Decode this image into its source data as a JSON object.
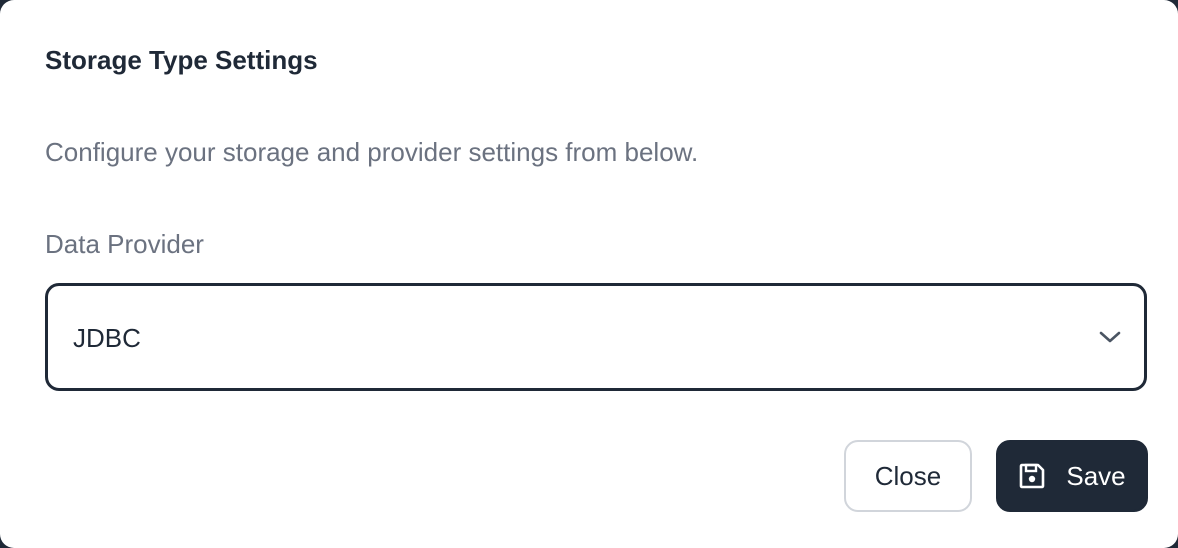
{
  "dialog": {
    "title": "Storage Type Settings",
    "description": "Configure your storage and provider settings from below."
  },
  "data_provider": {
    "label": "Data Provider",
    "selected": "JDBC"
  },
  "actions": {
    "close_label": "Close",
    "save_label": "Save"
  },
  "icons": {
    "select_chevron": "chevron-down-icon",
    "save": "floppy-disk-icon"
  },
  "colors": {
    "primary_dark": "#1f2937",
    "muted_text": "#6b7280",
    "border_light": "#d1d5db",
    "background": "#ffffff"
  }
}
